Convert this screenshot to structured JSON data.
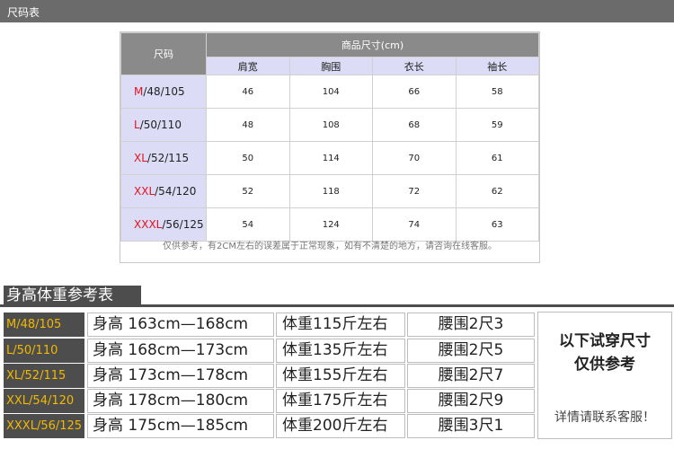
{
  "header": {
    "title": "尺码表"
  },
  "size_table": {
    "size_header": "尺码",
    "group_header": "商品尺寸(cm)",
    "columns": [
      "肩宽",
      "胸围",
      "衣长",
      "袖长"
    ],
    "rows": [
      {
        "size_letter": "M",
        "size_rest": "/48/105",
        "values": [
          "46",
          "104",
          "66",
          "58"
        ]
      },
      {
        "size_letter": "L",
        "size_rest": "/50/110",
        "values": [
          "48",
          "108",
          "68",
          "59"
        ]
      },
      {
        "size_letter": "XL",
        "size_rest": "/52/115",
        "values": [
          "50",
          "114",
          "70",
          "61"
        ]
      },
      {
        "size_letter": "XXL",
        "size_rest": "/54/120",
        "values": [
          "52",
          "118",
          "72",
          "62"
        ]
      },
      {
        "size_letter": "XXXL",
        "size_rest": "/56/125",
        "values": [
          "54",
          "124",
          "74",
          "63"
        ]
      }
    ],
    "note": "仅供参考，有2CM左右的误差属于正常现象，如有不清楚的地方，请咨询在线客服。"
  },
  "reference": {
    "title": "身高体重参考表",
    "rows": [
      {
        "size": "M/48/105",
        "height": "身高 163cm—168cm",
        "weight": "体重115斤左右",
        "waist": "腰围2尺3"
      },
      {
        "size": "L/50/110",
        "height": "身高 168cm—173cm",
        "weight": "体重135斤左右",
        "waist": "腰围2尺5"
      },
      {
        "size": "XL/52/115",
        "height": "身高 173cm—178cm",
        "weight": "体重155斤左右",
        "waist": "腰围2尺7"
      },
      {
        "size": "XXL/54/120",
        "height": "身高 178cm—180cm",
        "weight": "体重175斤左右",
        "waist": "腰围2尺9"
      },
      {
        "size": "XXXL/56/125",
        "height": "身高 175cm—185cm",
        "weight": "体重200斤左右",
        "waist": "腰围3尺1"
      }
    ],
    "side_line1": "以下试穿尺寸",
    "side_line2": "仅供参考",
    "side_line3": "详情请联系客服！"
  }
}
